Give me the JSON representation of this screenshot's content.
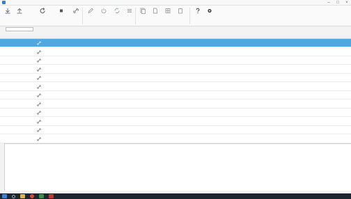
{
  "window": {
    "title": "",
    "menu": [
      {
        "label": ""
      },
      {
        "label": ""
      },
      {
        "label": ""
      },
      {
        "label": ""
      }
    ],
    "controls": {
      "minimize": "–",
      "maximize": "□",
      "close": "×"
    }
  },
  "toolbar": {
    "tools": [
      {
        "icon": "download-icon",
        "label": ""
      },
      {
        "icon": "upload-icon",
        "label": ""
      },
      {
        "icon": "refresh-icon",
        "label": ""
      },
      {
        "icon": "stop-icon",
        "label": ""
      },
      {
        "icon": "link-icon",
        "label": ""
      },
      {
        "icon": "edit-icon",
        "label": ""
      },
      {
        "icon": "power-icon",
        "label": ""
      },
      {
        "icon": "sync-icon",
        "label": ""
      },
      {
        "icon": "list-icon",
        "label": ""
      },
      {
        "icon": "copy-icon",
        "label": ""
      },
      {
        "icon": "document-icon",
        "label": ""
      },
      {
        "icon": "grid-icon",
        "label": ""
      },
      {
        "icon": "clipboard-icon",
        "label": ""
      },
      {
        "icon": "help-icon",
        "label": ""
      },
      {
        "icon": "settings-icon",
        "label": ""
      }
    ],
    "groups": [
      {
        "label": ""
      },
      {
        "label": ""
      },
      {
        "label": ""
      },
      {
        "label": ""
      }
    ]
  },
  "search": {
    "label": "",
    "value": ""
  },
  "tabs": [
    {
      "label": ""
    },
    {
      "label": ""
    },
    {
      "label": ""
    },
    {
      "label": ""
    },
    {
      "label": ""
    }
  ],
  "grid": {
    "columns": [
      {
        "label": ""
      },
      {
        "label": ""
      },
      {
        "label": ""
      },
      {
        "label": ""
      },
      {
        "label": ""
      },
      {
        "label": ""
      },
      {
        "label": ""
      },
      {
        "label": ""
      },
      {
        "label": ""
      },
      {
        "label": ""
      },
      {
        "label": ""
      },
      {
        "label": ""
      },
      {
        "label": ""
      }
    ],
    "rows": [
      {
        "num": "",
        "name": "",
        "count": ""
      },
      {
        "num": "",
        "name": "",
        "count": ""
      },
      {
        "num": "",
        "name": "",
        "count": ""
      },
      {
        "num": "",
        "name": "",
        "count": ""
      },
      {
        "num": "",
        "name": "",
        "count": ""
      },
      {
        "num": "",
        "name": "",
        "count": ""
      },
      {
        "num": "",
        "name": "",
        "count": ""
      },
      {
        "num": "",
        "name": "",
        "count": ""
      },
      {
        "num": "",
        "name": "",
        "count": ""
      },
      {
        "num": "",
        "name": "",
        "count": ""
      },
      {
        "num": "",
        "name": "",
        "count": ""
      },
      {
        "num": "",
        "name": "",
        "count": ""
      }
    ],
    "selected_row": 0
  },
  "log": [
    {
      "time": "",
      "message": ""
    },
    {
      "time": "",
      "message": ""
    },
    {
      "time": "",
      "message": ""
    },
    {
      "time": "",
      "message": ""
    },
    {
      "time": "",
      "message": ""
    },
    {
      "time": "",
      "message": ""
    },
    {
      "time": "",
      "message": ""
    },
    {
      "time": "",
      "message": ""
    },
    {
      "time": "",
      "message": ""
    },
    {
      "time": "",
      "message": ""
    },
    {
      "time": "",
      "message": ""
    },
    {
      "time": "",
      "message": ""
    },
    {
      "time": "",
      "message": ""
    },
    {
      "time": "",
      "message": ""
    },
    {
      "time": "",
      "message": ""
    }
  ],
  "status": {
    "text": ""
  },
  "taskbar": {
    "icons": [
      "start-icon",
      "search-icon",
      "file-explorer-icon",
      "chrome-icon",
      "app-icon",
      "alert-icon"
    ],
    "clock_time": "",
    "clock_date": ""
  },
  "colors": {
    "selection": "#4fa8e0",
    "brand": "#2f7fd3",
    "taskbar": "#1c2631"
  }
}
